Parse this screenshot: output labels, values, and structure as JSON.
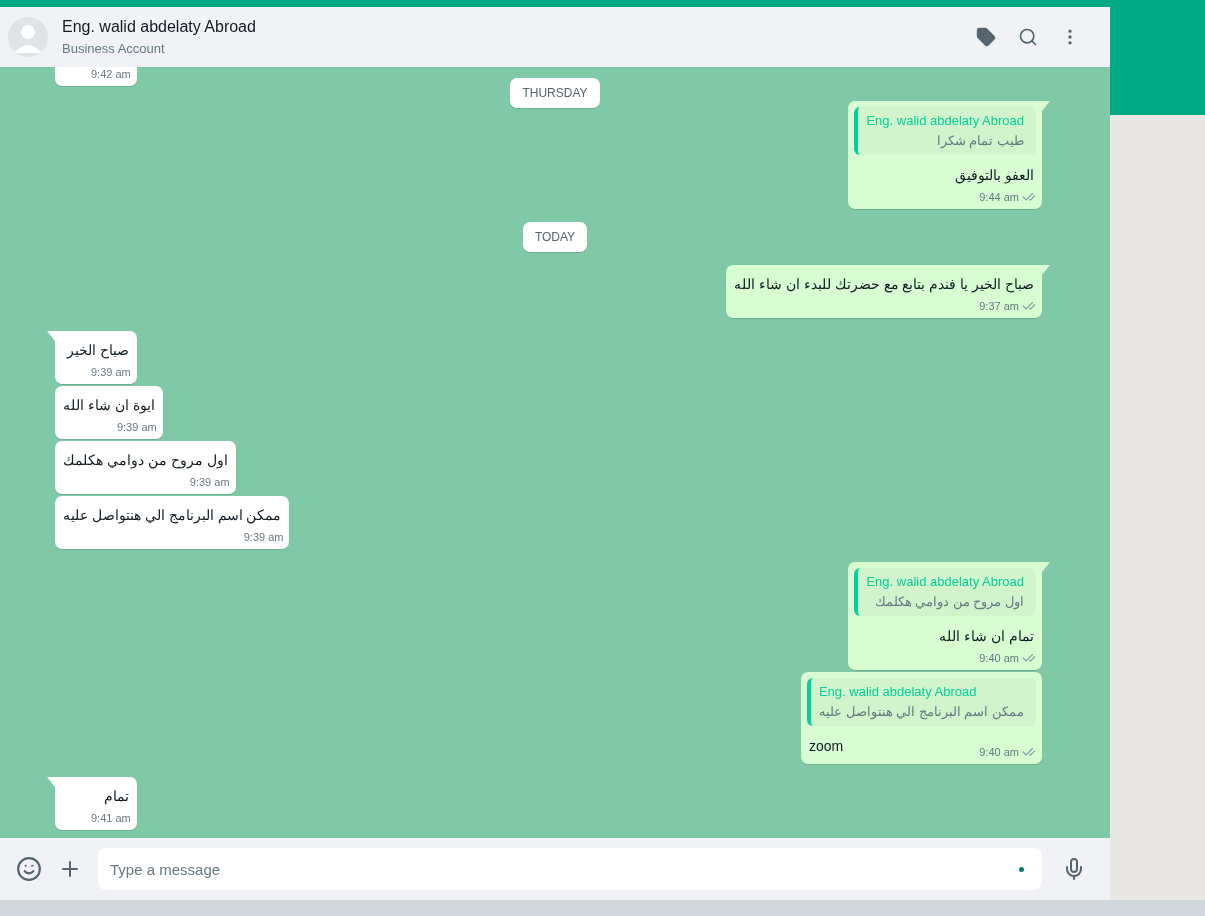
{
  "header": {
    "name": "Eng. walid abdelaty Abroad",
    "subtitle": "Business Account"
  },
  "messages": [
    {
      "kind": "in",
      "time": "9:42 am",
      "tail": false,
      "cut": true
    },
    {
      "kind": "date",
      "text": "THURSDAY"
    },
    {
      "kind": "out",
      "tail": true,
      "quote": {
        "author": "Eng. walid abdelaty Abroad",
        "text": "طيب تمام شكرا"
      },
      "text": "العفو بالتوفيق",
      "time": "9:44 am"
    },
    {
      "kind": "date",
      "text": "TODAY"
    },
    {
      "kind": "out",
      "tail": true,
      "text": "صباح الخير يا فندم بتابع مع حضرتك للبدء ان شاء الله",
      "time": "9:37 am"
    },
    {
      "kind": "in",
      "tail": true,
      "text": "صباح الخير",
      "time": "9:39 am"
    },
    {
      "kind": "in",
      "tail": false,
      "text": "ايوة ان شاء الله",
      "time": "9:39 am"
    },
    {
      "kind": "in",
      "tail": false,
      "text": "اول مروح من دوامي هكلمك",
      "time": "9:39 am"
    },
    {
      "kind": "in",
      "tail": false,
      "text": "ممكن اسم البرنامج الي هنتواصل عليه",
      "time": "9:39 am"
    },
    {
      "kind": "out",
      "tail": true,
      "quote": {
        "author": "Eng. walid abdelaty Abroad",
        "text": "اول مروح من دوامي هكلمك"
      },
      "text": "تمام ان شاء الله",
      "time": "9:40 am"
    },
    {
      "kind": "out",
      "tail": false,
      "quote": {
        "author": "Eng. walid abdelaty Abroad",
        "text": "ممكن اسم البرنامج الي هنتواصل عليه"
      },
      "text": "zoom",
      "time": "9:40 am"
    },
    {
      "kind": "in",
      "tail": true,
      "text": "تمام",
      "time": "9:41 am"
    }
  ],
  "composer": {
    "placeholder": "Type a message"
  }
}
